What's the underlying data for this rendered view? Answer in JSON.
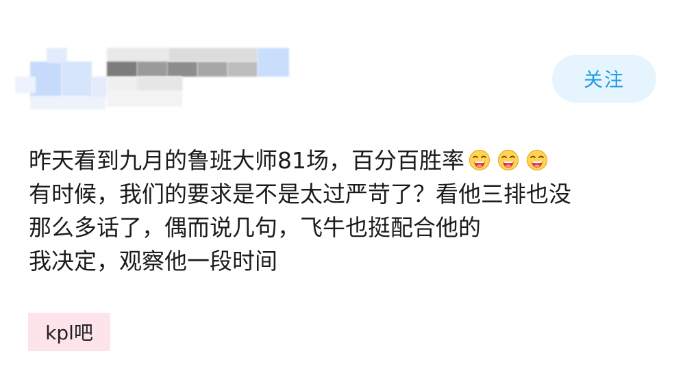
{
  "header": {
    "follow_label": "关注"
  },
  "post": {
    "lines": [
      "昨天看到九月的鲁班大师81场，百分百胜率",
      "有时候，我们的要求是不是太过严苛了？看他三排也没",
      "那么多话了，偶而说几句，飞牛也挺配合他的",
      "我决定，观察他一段时间"
    ],
    "emojis": [
      "grin-emoji",
      "grin-emoji",
      "grin-emoji"
    ]
  },
  "tag": {
    "label": "kpl吧",
    "background": "#fde3ea"
  },
  "colors": {
    "accent": "#1e9be8",
    "follow_bg": "#e6f5fd",
    "text": "#1b1b1b"
  }
}
